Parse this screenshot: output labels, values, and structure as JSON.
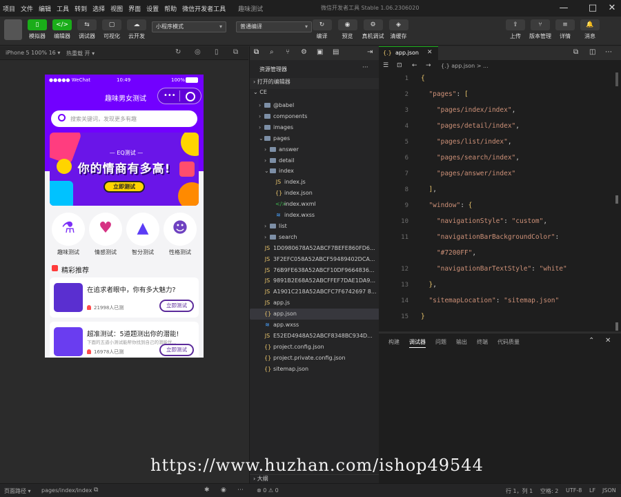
{
  "menu": [
    "项目",
    "文件",
    "编辑",
    "工具",
    "转到",
    "选择",
    "视图",
    "界面",
    "设置",
    "帮助",
    "微信开发者工具"
  ],
  "menu_project_title": "趣味测试",
  "window_title": "微信开发者工具 Stable 1.06.2306020",
  "window_controls": {
    "minimize": "—",
    "maximize": "□",
    "close": "✕"
  },
  "toolbar": {
    "left_buttons": [
      {
        "label": "模拟器",
        "icon": "phone-icon",
        "glyph": "▯"
      },
      {
        "label": "编辑器",
        "icon": "code-icon",
        "glyph": "</>"
      },
      {
        "label": "调试器",
        "icon": "debug-icon",
        "glyph": "⇆"
      },
      {
        "label": "可视化",
        "icon": "visual-icon",
        "glyph": "▢"
      },
      {
        "label": "云开发",
        "icon": "cloud-icon",
        "glyph": "☁"
      }
    ],
    "mode_select": "小程序模式",
    "compile_select": "普通编译",
    "middle_buttons": [
      {
        "label": "编译",
        "glyph": "↻"
      },
      {
        "label": "预览",
        "glyph": "◉"
      },
      {
        "label": "真机调试",
        "glyph": "⚙"
      },
      {
        "label": "清缓存",
        "glyph": "◈"
      }
    ],
    "right_buttons": [
      {
        "label": "上传",
        "glyph": "⇪"
      },
      {
        "label": "版本管理",
        "glyph": "⑂"
      },
      {
        "label": "详情",
        "glyph": "≡"
      },
      {
        "label": "消息",
        "glyph": "🔔"
      }
    ]
  },
  "simulator": {
    "device": "iPhone 5 100% 16 ▾",
    "hot_reload": "热重载 开 ▾"
  },
  "phone": {
    "status_carrier": "●●●●● WeChat",
    "status_time": "10:49",
    "status_battery": "100%",
    "nav_title": "趣味男女测试",
    "capsule_dots": "•••",
    "search_placeholder": "搜索关键词，发现更多有趣",
    "banner_tag": "— EQ测试 —",
    "banner_title": "你的情商有多高!",
    "banner_button": "立即测试",
    "categories": [
      {
        "label": "趣味测试",
        "icon": "flask-icon",
        "glyph": "⚗"
      },
      {
        "label": "情感测试",
        "icon": "heart-icon",
        "glyph": "♥"
      },
      {
        "label": "智分测试",
        "icon": "triangle-icon",
        "glyph": "▲"
      },
      {
        "label": "性格测试",
        "icon": "head-icon",
        "glyph": "☻"
      }
    ],
    "section_title": "精彩推荐",
    "cards": [
      {
        "title": "在追求者眼中，你有多大魅力?",
        "subtitle": "",
        "count": "21998人已测",
        "button": "立即测试"
      },
      {
        "title": "超准测试：5道题测出你的潜能!",
        "subtitle": "下面的五道小测试能帮你找到自己的潜能优...",
        "count": "16978人已测",
        "button": "立即测试"
      }
    ]
  },
  "explorer": {
    "header": "资源管理器",
    "more": "···",
    "open_editors": "打开的编辑器",
    "root": "CE",
    "items": [
      {
        "name": "@babel",
        "type": "folder",
        "depth": 1,
        "open": false
      },
      {
        "name": "components",
        "type": "folder",
        "depth": 1,
        "open": false
      },
      {
        "name": "images",
        "type": "folder",
        "depth": 1,
        "open": false
      },
      {
        "name": "pages",
        "type": "folder",
        "depth": 1,
        "open": true
      },
      {
        "name": "answer",
        "type": "folder",
        "depth": 2,
        "open": false
      },
      {
        "name": "detail",
        "type": "folder",
        "depth": 2,
        "open": false
      },
      {
        "name": "index",
        "type": "folder",
        "depth": 2,
        "open": true
      },
      {
        "name": "index.js",
        "type": "js",
        "depth": 3
      },
      {
        "name": "index.json",
        "type": "json",
        "depth": 3
      },
      {
        "name": "index.wxml",
        "type": "wxml",
        "depth": 3
      },
      {
        "name": "index.wxss",
        "type": "wxss",
        "depth": 3
      },
      {
        "name": "list",
        "type": "folder",
        "depth": 2,
        "open": false
      },
      {
        "name": "search",
        "type": "folder",
        "depth": 2,
        "open": false
      },
      {
        "name": "1D0980678A52ABCF7BEFE860FD6...",
        "type": "js",
        "depth": 1
      },
      {
        "name": "3F2EFC058A52ABCF59489402DCA...",
        "type": "js",
        "depth": 1
      },
      {
        "name": "76B9FE638A52ABCF10DF9664836...",
        "type": "js",
        "depth": 1
      },
      {
        "name": "9891B2E68A52ABCFFEF7DAE1DA9...",
        "type": "js",
        "depth": 1
      },
      {
        "name": "A1901C218A52ABCFC7F6742697 8...",
        "type": "js",
        "depth": 1
      },
      {
        "name": "app.js",
        "type": "js",
        "depth": 1
      },
      {
        "name": "app.json",
        "type": "json",
        "depth": 1,
        "selected": true
      },
      {
        "name": "app.wxss",
        "type": "wxss",
        "depth": 1
      },
      {
        "name": "E52ED4948A52ABCF8348BC934D...",
        "type": "js",
        "depth": 1
      },
      {
        "name": "project.config.json",
        "type": "json",
        "depth": 1
      },
      {
        "name": "project.private.config.json",
        "type": "json",
        "depth": 1
      },
      {
        "name": "sitemap.json",
        "type": "json",
        "depth": 1
      }
    ],
    "outline": "大纲"
  },
  "editor": {
    "tab": "app.json",
    "breadcrumb": "{.} app.json > ...",
    "lines": [
      {
        "n": "1",
        "t": "{"
      },
      {
        "n": "2",
        "t": "  \"pages\": ["
      },
      {
        "n": "3",
        "t": "    \"pages/index/index\","
      },
      {
        "n": "4",
        "t": "    \"pages/detail/index\","
      },
      {
        "n": "5",
        "t": "    \"pages/list/index\","
      },
      {
        "n": "6",
        "t": "    \"pages/search/index\","
      },
      {
        "n": "7",
        "t": "    \"pages/answer/index\""
      },
      {
        "n": "8",
        "t": "  ],"
      },
      {
        "n": "9",
        "t": "  \"window\": {"
      },
      {
        "n": "10",
        "t": "    \"navigationStyle\": \"custom\","
      },
      {
        "n": "11",
        "t": "    \"navigationBarBackgroundColor\":"
      },
      {
        "n": "",
        "t": "    \"#7200FF\","
      },
      {
        "n": "12",
        "t": "    \"navigationBarTextStyle\": \"white\""
      },
      {
        "n": "13",
        "t": "  },"
      },
      {
        "n": "14",
        "t": "  \"sitemapLocation\": \"sitemap.json\""
      },
      {
        "n": "15",
        "t": "}"
      }
    ]
  },
  "console": {
    "tabs": [
      "构建",
      "调试器",
      "问题",
      "输出",
      "终端",
      "代码质量"
    ],
    "active": "调试器"
  },
  "statusbar": {
    "page_path_label": "页面路径 ▾",
    "page_path": "pages/index/index",
    "errors": "⊗ 0 ⚠ 0",
    "position": "行 1，列 1",
    "spaces": "空格: 2",
    "encoding": "UTF-8",
    "eol": "LF",
    "language": "JSON"
  },
  "watermark": "https://www.huzhan.com/ishop49544",
  "colors": {
    "brand": "#7200ff",
    "accent_green": "#1aad19",
    "banner_yellow": "#ffd400"
  }
}
